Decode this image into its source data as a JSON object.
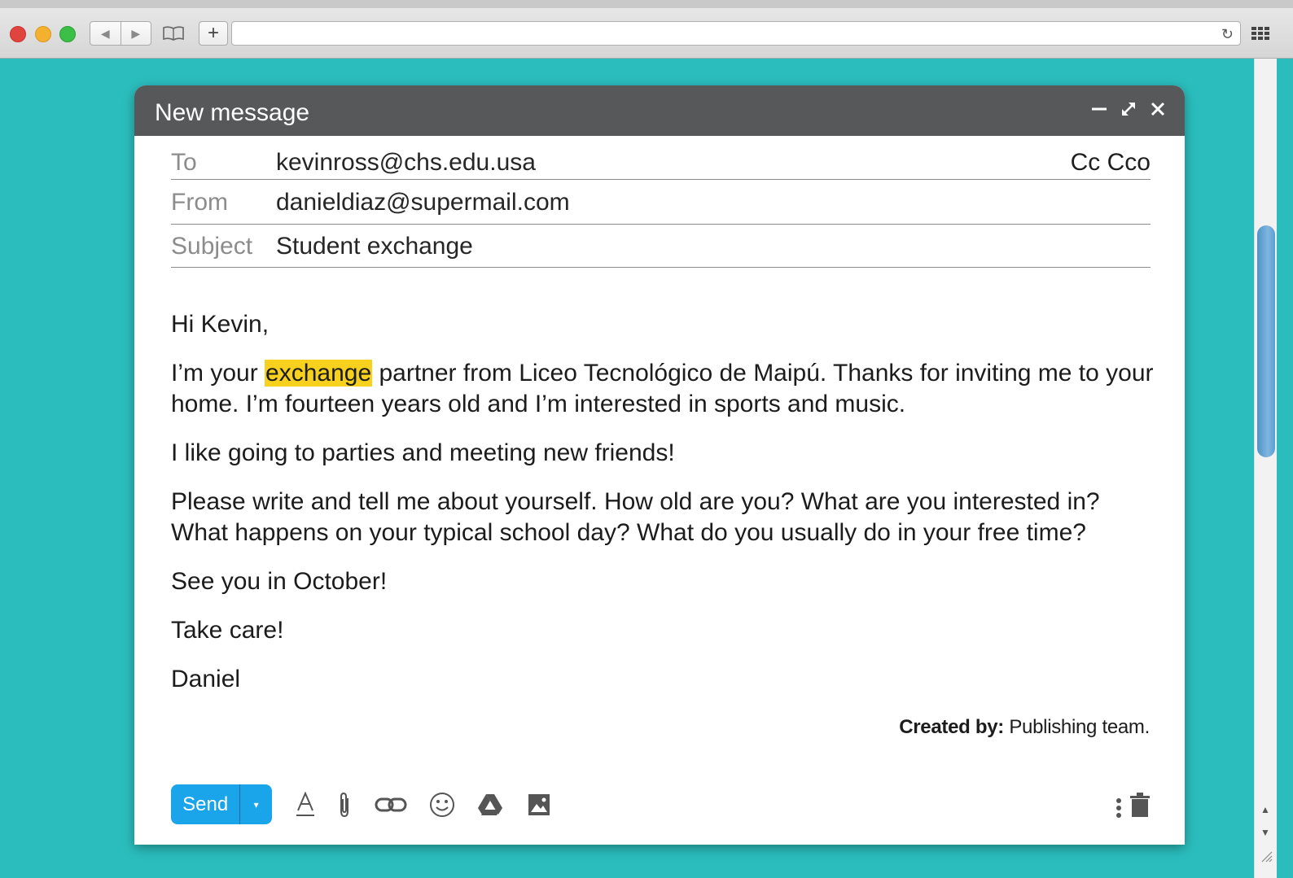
{
  "browser": {
    "back_glyph": "◀",
    "forward_glyph": "▶",
    "new_tab_glyph": "+",
    "reload_glyph": "↻",
    "url": ""
  },
  "compose": {
    "title": "New message",
    "fields": {
      "to_label": "To",
      "to_value": "kevinross@chs.edu.usa",
      "cc_label": "Cc Cco",
      "from_label": "From",
      "from_value": "danieldiaz@supermail.com",
      "subject_label": "Subject",
      "subject_value": "Student exchange"
    },
    "body": {
      "greeting": "Hi Kevin,",
      "p1_before": "I’m your ",
      "p1_highlight": "exchange",
      "p1_after": " partner from Liceo Tecnológico de Maipú. Thanks for inviting me to your home. I’m fourteen years old and I’m interested in sports and music.",
      "p2": "I like going to parties and meeting new friends!",
      "p3": "Please write and tell me about yourself. How old are you? What are you interested in? What happens on your typical school day? What do you usually do in your free time?",
      "p4": "See you in October!",
      "p5": "Take care!",
      "signature": "Daniel"
    },
    "credit_label": "Created by:",
    "credit_value": " Publishing team.",
    "toolbar": {
      "send_label": "Send",
      "send_dropdown_glyph": "▾"
    }
  },
  "colors": {
    "background": "#2bbdbd",
    "header": "#57585a",
    "send": "#1aa4ea",
    "highlight": "#f7d11d"
  },
  "icons": [
    "minimize-icon",
    "expand-icon",
    "close-icon",
    "text-format-icon",
    "attachment-icon",
    "link-icon",
    "emoji-icon",
    "drive-icon",
    "image-icon",
    "more-options-icon",
    "trash-icon"
  ]
}
